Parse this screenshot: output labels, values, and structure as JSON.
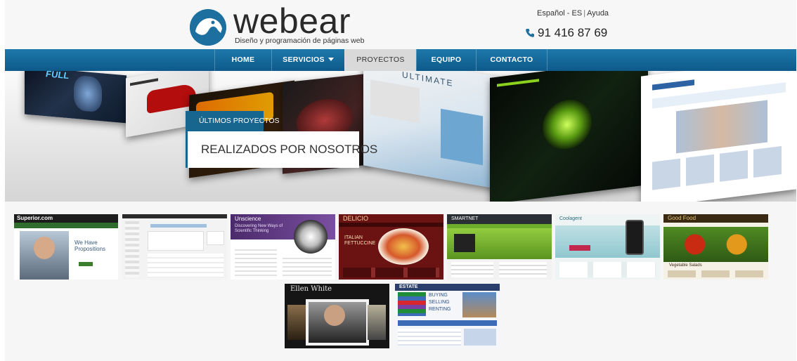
{
  "header": {
    "logo_text": "webear",
    "tagline": "Diseño y programación de páginas web",
    "lang_label": "Español - ES",
    "help_label": "Ayuda",
    "phone": "91 416 87 69"
  },
  "nav": {
    "items": [
      {
        "label": "HOME"
      },
      {
        "label": "SERVICIOS"
      },
      {
        "label": "PROYECTOS"
      },
      {
        "label": "EQUIPO"
      },
      {
        "label": "CONTACTO"
      }
    ],
    "active": "PROYECTOS"
  },
  "banner": {
    "kicker": "ÚLTIMOS PROYECTOS",
    "title": "REALIZADOS POR NOSOTROS",
    "shot_texts": [
      "FULL",
      "ULTIMATE"
    ]
  },
  "gallery": {
    "thumbs": [
      {
        "caption": "Superior.com",
        "headline": "We Have Propositions"
      },
      {
        "caption": "",
        "headline": ""
      },
      {
        "caption": "Unscience",
        "headline": "Discovering New Ways of Scientific Thinking"
      },
      {
        "caption": "DELICIO",
        "headline": "ITALIAN FETTUCCINE"
      },
      {
        "caption": "SMARTNET",
        "headline": ""
      },
      {
        "caption": "Coolagent",
        "headline": ""
      },
      {
        "caption": "Good Food",
        "headline": "Vegetable Salads"
      },
      {
        "caption": "Ellen White",
        "headline": ""
      },
      {
        "caption": "ESTATE",
        "headline": "BUYING SELLING RENTING"
      }
    ]
  },
  "colors": {
    "brand_blue": "#17668f",
    "nav_gradient_top": "#1e78ab",
    "nav_gradient_bottom": "#0d5a8a",
    "active_tab": "#d9d9d9"
  }
}
